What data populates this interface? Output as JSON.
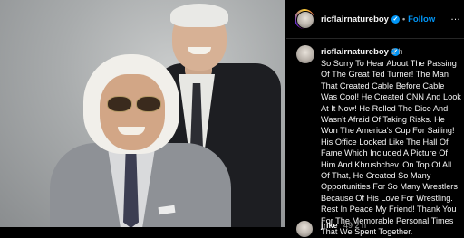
{
  "header": {
    "username": "ricflairnatureboy",
    "verified_icon": "verified-badge-icon",
    "follow_label": "Follow",
    "more_label": "…",
    "separator": "•"
  },
  "caption": {
    "username": "ricflairnatureboy",
    "time": "2 h",
    "text": "So Sorry To Hear About The Passing Of The Great Ted Turner! The Man That Created Cable Before Cable Was Cool! He Created CNN And Look At It Now! He Rolled The Dice And Wasn’t Afraid Of Taking Risks. He Won The America’s Cup For Sailing! His Office Looked Like The Hall Of Fame Which Included A Picture Of Him And Khrushchev. On Top Of All Of That, He Created So Many Opportunities For So Many Wrestlers Because Of His Love For Wrestling. Rest In Peace My Friend! Thank You For The Memorable Personal Times That We Spent Together."
  },
  "next_comment": {
    "username": "jrike",
    "time": "49 2 h"
  },
  "colors": {
    "accent": "#0095f6",
    "background": "#000000",
    "text": "#f5f5f5",
    "muted": "#a8a8a8"
  }
}
